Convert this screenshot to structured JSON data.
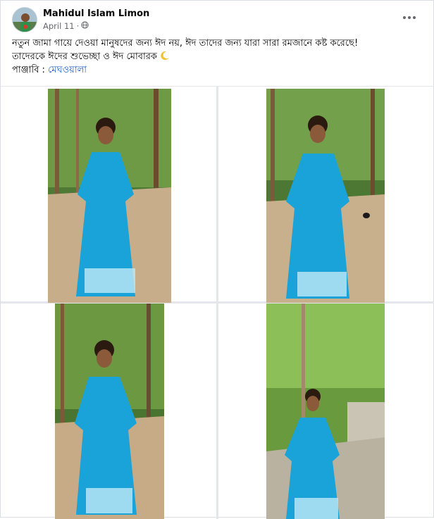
{
  "post": {
    "author": "Mahidul Islam Limon",
    "date": "April 11",
    "separator": "·",
    "privacy_icon": "globe-icon",
    "more_icon": "more-options-icon",
    "text_line1": "নতুন জামা গায়ে দেওয়া মানুষদের জন্য ঈদ নয়, ঈদ তাদের জন্য যারা সারা রমজানে কষ্ট করেছে!",
    "text_line2": "তাদেরকে ঈদের শুভেচ্ছা ও ঈদ মোবারক",
    "moon_icon": "crescent-moon-icon",
    "text_line3_prefix": "পাঞ্জাবি : ",
    "text_line3_link": "মেঘওয়ালা"
  },
  "colors": {
    "panjabi": "#1aa3d9",
    "foliage": "#3e6b2a",
    "path": "#c7ad8a",
    "link": "#1f5fc7"
  }
}
